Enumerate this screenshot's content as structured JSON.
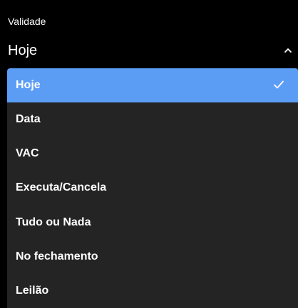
{
  "validity_field": {
    "label": "Validade",
    "selected_value": "Hoje",
    "chevron_icon": "chevron-up-icon"
  },
  "menu": {
    "accent_color": "#5b9cf5",
    "background_color": "#242424",
    "selected_index": 0,
    "check_icon": "check-icon",
    "items": [
      {
        "label": "Hoje"
      },
      {
        "label": "Data"
      },
      {
        "label": "VAC"
      },
      {
        "label": "Executa/Cancela"
      },
      {
        "label": "Tudo ou Nada"
      },
      {
        "label": "No fechamento"
      },
      {
        "label": "Leilão"
      }
    ]
  }
}
